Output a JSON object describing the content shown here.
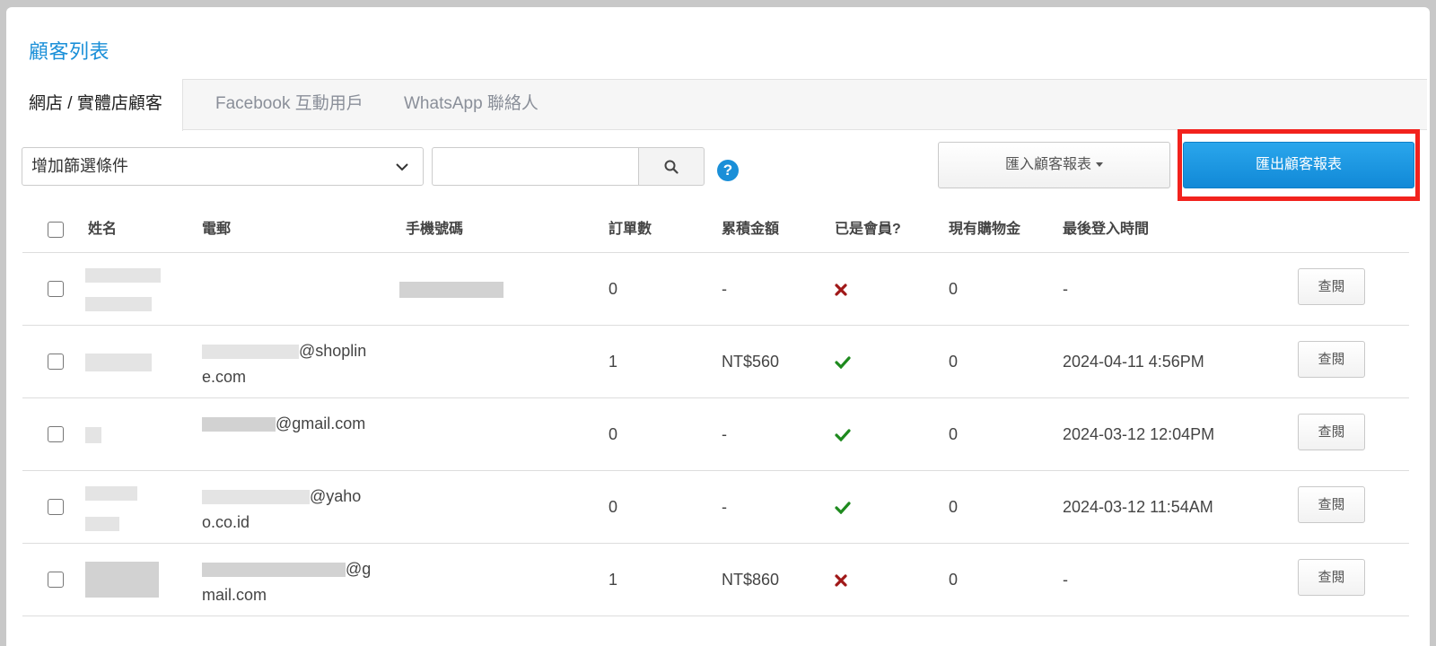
{
  "page": {
    "title": "顧客列表"
  },
  "tabs": [
    {
      "label": "網店 / 實體店顧客",
      "active": true
    },
    {
      "label": "Facebook 互動用戶",
      "active": false
    },
    {
      "label": "WhatsApp 聯絡人",
      "active": false
    }
  ],
  "toolbar": {
    "filter_placeholder": "增加篩選條件",
    "search_value": "",
    "import_label": "匯入顧客報表",
    "export_label": "匯出顧客報表"
  },
  "colors": {
    "accent": "#1a8fd8",
    "highlight": "#f2221d",
    "member_yes": "#1e8a1e",
    "member_no": "#a01818"
  },
  "table": {
    "headers": {
      "name": "姓名",
      "email": "電郵",
      "phone": "手機號碼",
      "orders": "訂單數",
      "total": "累積金額",
      "member": "已是會員?",
      "credit": "現有購物金",
      "last_login": "最後登入時間"
    },
    "view_label": "查閱",
    "rows": [
      {
        "email_suffix": "",
        "orders": "0",
        "total": "-",
        "member": false,
        "credit": "0",
        "last_login": "-"
      },
      {
        "email_suffix": "@shopline.com",
        "orders": "1",
        "total": "NT$560",
        "member": true,
        "credit": "0",
        "last_login": "2024-04-11 4:56PM"
      },
      {
        "email_suffix": "@gmail.com",
        "orders": "0",
        "total": "-",
        "member": true,
        "credit": "0",
        "last_login": "2024-03-12 12:04PM"
      },
      {
        "email_suffix": "@yahoo.co.id",
        "orders": "0",
        "total": "-",
        "member": true,
        "credit": "0",
        "last_login": "2024-03-12 11:54AM"
      },
      {
        "email_suffix": "@gmail.com",
        "orders": "1",
        "total": "NT$860",
        "member": false,
        "credit": "0",
        "last_login": "-"
      }
    ]
  }
}
